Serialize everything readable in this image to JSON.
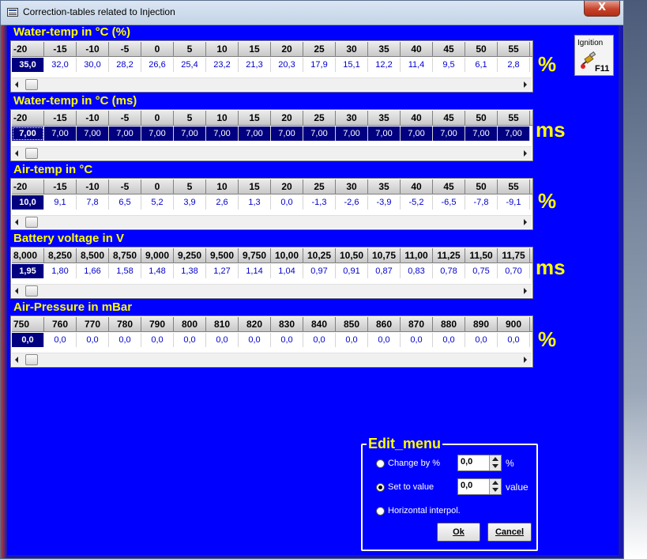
{
  "window": {
    "title": "Correction-tables related to Injection",
    "close_label": "X"
  },
  "ignition_button": {
    "label": "Ignition",
    "key": "F11"
  },
  "tables": [
    {
      "title": "Water-temp in °C (%)",
      "unit": "%",
      "headers": [
        "-20",
        "-15",
        "-10",
        "-5",
        "0",
        "5",
        "10",
        "15",
        "20",
        "25",
        "30",
        "35",
        "40",
        "45",
        "50",
        "55"
      ],
      "values": [
        "35,0",
        "32,0",
        "30,0",
        "28,2",
        "26,6",
        "25,4",
        "23,2",
        "21,3",
        "20,3",
        "17,9",
        "15,1",
        "12,2",
        "11,4",
        "9,5",
        "6,1",
        "2,8"
      ]
    },
    {
      "title": "Water-temp in °C (ms)",
      "unit": "ms",
      "headers": [
        "-20",
        "-15",
        "-10",
        "-5",
        "0",
        "5",
        "10",
        "15",
        "20",
        "25",
        "30",
        "35",
        "40",
        "45",
        "50",
        "55"
      ],
      "values": [
        "7,00",
        "7,00",
        "7,00",
        "7,00",
        "7,00",
        "7,00",
        "7,00",
        "7,00",
        "7,00",
        "7,00",
        "7,00",
        "7,00",
        "7,00",
        "7,00",
        "7,00",
        "7,00"
      ]
    },
    {
      "title": "Air-temp in °C",
      "unit": "%",
      "headers": [
        "-20",
        "-15",
        "-10",
        "-5",
        "0",
        "5",
        "10",
        "15",
        "20",
        "25",
        "30",
        "35",
        "40",
        "45",
        "50",
        "55"
      ],
      "values": [
        "10,0",
        "9,1",
        "7,8",
        "6,5",
        "5,2",
        "3,9",
        "2,6",
        "1,3",
        "0,0",
        "-1,3",
        "-2,6",
        "-3,9",
        "-5,2",
        "-6,5",
        "-7,8",
        "-9,1"
      ]
    },
    {
      "title": "Battery voltage in V",
      "unit": "ms",
      "headers": [
        "8,000",
        "8,250",
        "8,500",
        "8,750",
        "9,000",
        "9,250",
        "9,500",
        "9,750",
        "10,00",
        "10,25",
        "10,50",
        "10,75",
        "11,00",
        "11,25",
        "11,50",
        "11,75"
      ],
      "values": [
        "1,95",
        "1,80",
        "1,66",
        "1,58",
        "1,48",
        "1,38",
        "1,27",
        "1,14",
        "1,04",
        "0,97",
        "0,91",
        "0,87",
        "0,83",
        "0,78",
        "0,75",
        "0,70"
      ]
    },
    {
      "title": "Air-Pressure in mBar",
      "unit": "%",
      "headers": [
        "750",
        "760",
        "770",
        "780",
        "790",
        "800",
        "810",
        "820",
        "830",
        "840",
        "850",
        "860",
        "870",
        "880",
        "890",
        "900"
      ],
      "values": [
        "0,0",
        "0,0",
        "0,0",
        "0,0",
        "0,0",
        "0,0",
        "0,0",
        "0,0",
        "0,0",
        "0,0",
        "0,0",
        "0,0",
        "0,0",
        "0,0",
        "0,0",
        "0,0"
      ]
    }
  ],
  "edit_menu": {
    "title": "Edit_menu",
    "options": [
      {
        "label": "Change by %",
        "value": "0,0",
        "unit": "%",
        "checked": false
      },
      {
        "label": "Set to value",
        "value": "0,0",
        "unit": "value",
        "checked": true
      },
      {
        "label": "Horizontal interpol.",
        "checked": false
      }
    ],
    "ok_label": "Ok",
    "cancel_label": "Cancel"
  }
}
